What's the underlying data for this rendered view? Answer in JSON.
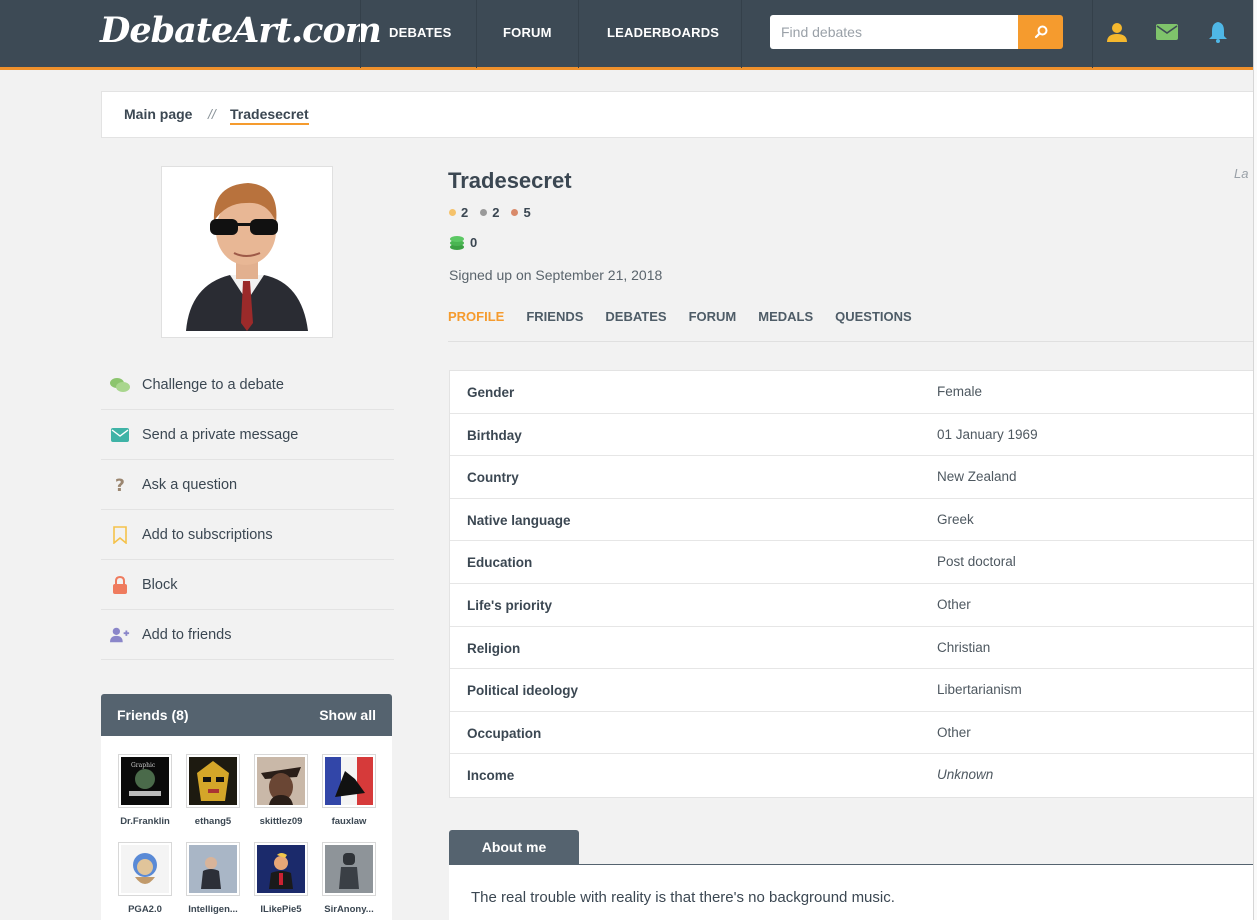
{
  "header": {
    "logo": "DebateArt.com",
    "nav": [
      "DEBATES",
      "FORUM",
      "LEADERBOARDS"
    ],
    "search_placeholder": "Find debates"
  },
  "breadcrumb": {
    "main": "Main page",
    "separator": "//",
    "current": "Tradesecret"
  },
  "actions": [
    {
      "label": "Challenge to a debate",
      "icon": "chat-bubbles-icon"
    },
    {
      "label": "Send a private message",
      "icon": "envelope-icon"
    },
    {
      "label": "Ask a question",
      "icon": "question-mark-icon"
    },
    {
      "label": "Add to subscriptions",
      "icon": "bookmark-icon"
    },
    {
      "label": "Block",
      "icon": "lock-icon"
    },
    {
      "label": "Add to friends",
      "icon": "add-user-icon"
    }
  ],
  "friends": {
    "title": "Friends (8)",
    "show_all": "Show all",
    "list": [
      "Dr.Franklin",
      "ethang5",
      "skittlez09",
      "fauxlaw",
      "PGA2.0",
      "Intelligen...",
      "ILikePie5",
      "SirAnony..."
    ]
  },
  "profile": {
    "username": "Tradesecret",
    "medals": {
      "gold": "2",
      "silver": "2",
      "bronze": "5"
    },
    "coins": "0",
    "signed_up": "Signed up on September 21, 2018",
    "tabs": [
      "PROFILE",
      "FRIENDS",
      "DEBATES",
      "FORUM",
      "MEDALS",
      "QUESTIONS"
    ],
    "stray_label": "La"
  },
  "info": [
    {
      "key": "Gender",
      "value": "Female"
    },
    {
      "key": "Birthday",
      "value": "01 January 1969"
    },
    {
      "key": "Country",
      "value": "New Zealand"
    },
    {
      "key": "Native language",
      "value": "Greek"
    },
    {
      "key": "Education",
      "value": "Post doctoral"
    },
    {
      "key": "Life's priority",
      "value": "Other"
    },
    {
      "key": "Religion",
      "value": "Christian"
    },
    {
      "key": "Political ideology",
      "value": "Libertarianism"
    },
    {
      "key": "Occupation",
      "value": "Other"
    },
    {
      "key": "Income",
      "value": "Unknown"
    }
  ],
  "about": {
    "tab": "About me",
    "text": "The real trouble with reality is that there's no background music."
  },
  "colors": {
    "nav_bg": "#3d4a55",
    "accent": "#f59b2e",
    "panel_head": "#55636f",
    "gold": "#f5c26b",
    "silver": "#9a9a9a",
    "bronze": "#d98a6a"
  }
}
